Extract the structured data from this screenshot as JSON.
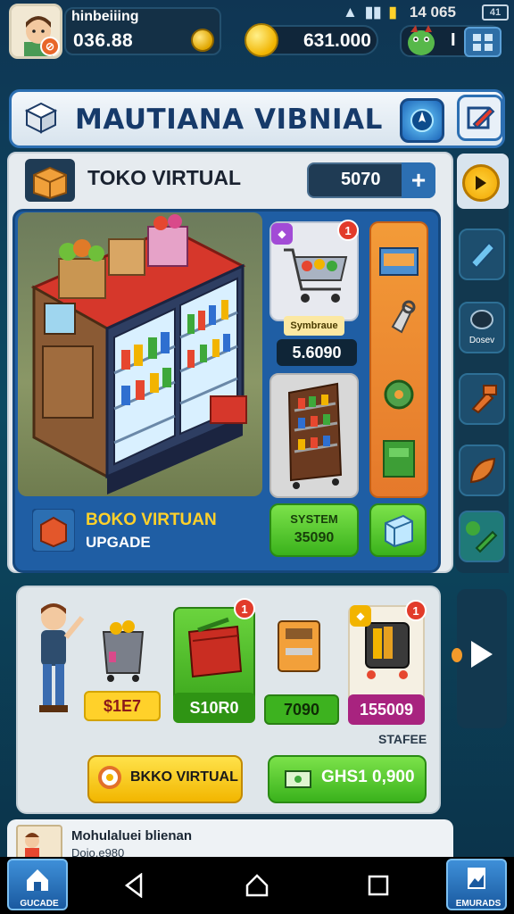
{
  "status": {
    "time": "14 065",
    "battery": "41"
  },
  "player": {
    "name": "hinbeiiing",
    "value": "036.88",
    "avatar_badge": "⊘"
  },
  "currency": {
    "coins": "631.000",
    "gems": "I"
  },
  "header": {
    "title": "MAUTIANA VIBNIAL"
  },
  "toko": {
    "title": "TOKO VIRTUAL",
    "counter": "5070",
    "plus": "+"
  },
  "cards": {
    "top_badge": "1",
    "top_label": "Symbraue",
    "top_price": "5.6090"
  },
  "upgrade": {
    "title": "BOKO VIRTUAN",
    "subtitle": "UPGADE",
    "system_label": "SYSTEM",
    "system_price": "35090"
  },
  "side": {
    "text_label": "Dosev"
  },
  "bottom": {
    "prices": [
      "$1E7",
      "S10R0",
      "7090",
      "155009"
    ],
    "badges": [
      "1",
      "1"
    ],
    "stafee": "STAFEE",
    "toko_button": "BKKO VIRTUAL",
    "ghs_button": "GHS1 0,900"
  },
  "footer": {
    "name": "Mohulaluei blienan",
    "sub": "Doio.e980"
  },
  "nav": {
    "left_label": "GUCADE",
    "right_label": "EMURADS"
  },
  "colors": {
    "background": "#0f3553",
    "header_border": "#2c6fb2",
    "accent_yellow": "#ffd12a",
    "accent_green": "#3ab21c",
    "accent_orange": "#e5792b"
  }
}
